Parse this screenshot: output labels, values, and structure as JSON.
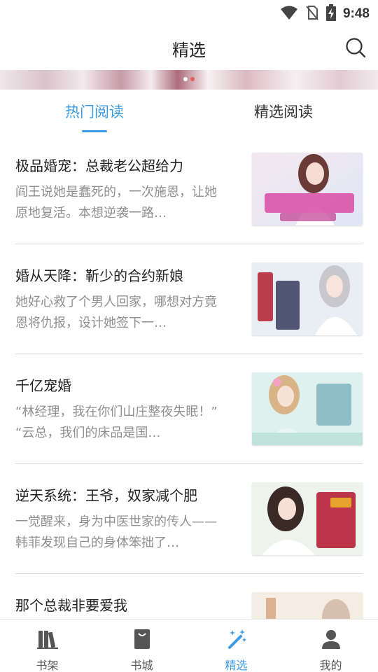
{
  "status_bar": {
    "time": "9:48"
  },
  "header": {
    "title": "精选"
  },
  "tabs": [
    {
      "label": "热门阅读",
      "active": true
    },
    {
      "label": "精选阅读",
      "active": false
    }
  ],
  "books": [
    {
      "title": "极品婚宠：总裁老公超给力",
      "desc": "阎王说她是蠢死的，一次施恩，让她原地复活。本想逆袭一路…"
    },
    {
      "title": "婚从天降：靳少的合约新娘",
      "desc": "她好心救了个男人回家，哪想对方竟恩将仇报，设计她签下一…"
    },
    {
      "title": "千亿宠婚",
      "desc": "“林经理，我在你们山庄整夜失眠！” “云总，我们的床品是国…"
    },
    {
      "title": "逆天系统：王爷，奴家减个肥",
      "desc": "一觉醒来，身为中医世家的传人——韩菲发现自己的身体笨拙了…"
    },
    {
      "title": "那个总裁非要爱我",
      "desc": ""
    }
  ],
  "bottom_nav": [
    {
      "label": "书架",
      "icon": "bookshelf-icon",
      "active": false
    },
    {
      "label": "书城",
      "icon": "bookstore-icon",
      "active": false
    },
    {
      "label": "精选",
      "icon": "magic-wand-icon",
      "active": true
    },
    {
      "label": "我的",
      "icon": "profile-icon",
      "active": false
    }
  ],
  "colors": {
    "accent": "#3d9be3",
    "text": "#222222",
    "secondary_text": "#8f8f8f",
    "divider": "#dcdcdc"
  }
}
